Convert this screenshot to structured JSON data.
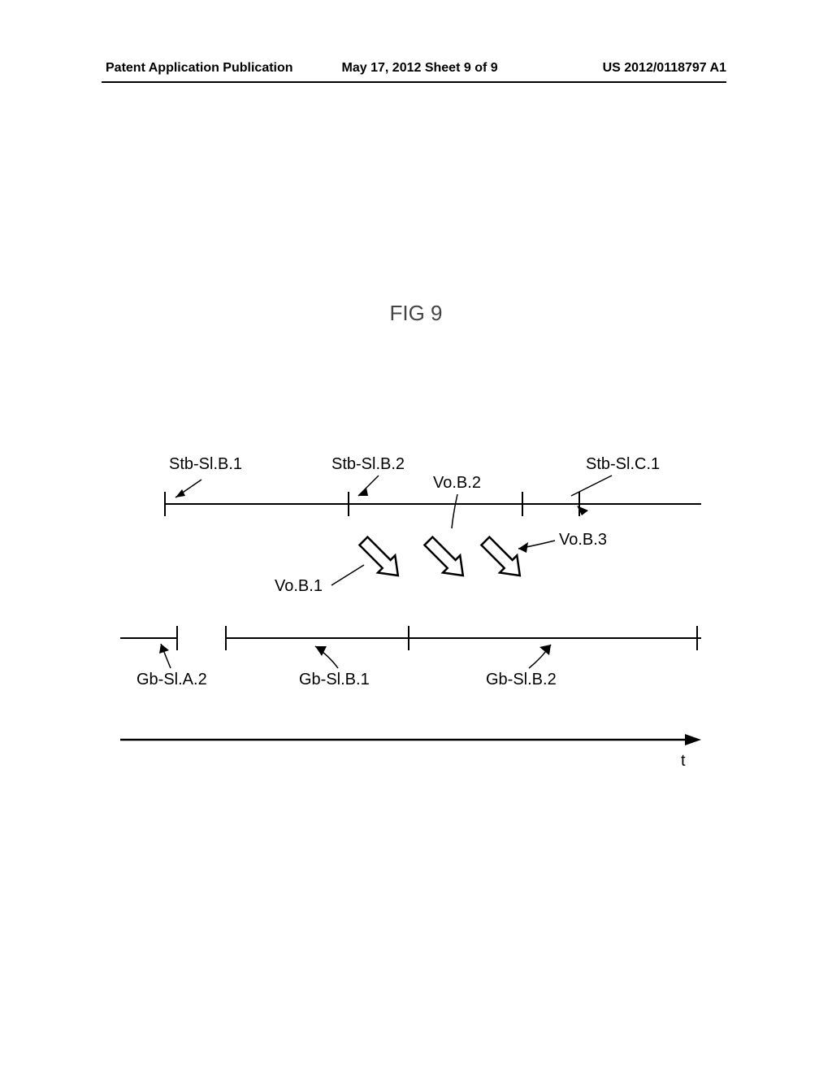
{
  "header": {
    "left": "Patent Application Publication",
    "center": "May 17, 2012  Sheet 9 of 9",
    "right": "US 2012/0118797 A1"
  },
  "figure": {
    "title": "FIG 9"
  },
  "labels": {
    "stb_b1": "Stb-Sl.B.1",
    "stb_b2": "Stb-Sl.B.2",
    "stb_c1": "Stb-Sl.C.1",
    "vo_b1": "Vo.B.1",
    "vo_b2": "Vo.B.2",
    "vo_b3": "Vo.B.3",
    "gb_a2": "Gb-Sl.A.2",
    "gb_b1": "Gb-Sl.B.1",
    "gb_b2": "Gb-Sl.B.2",
    "time_axis": "t"
  }
}
